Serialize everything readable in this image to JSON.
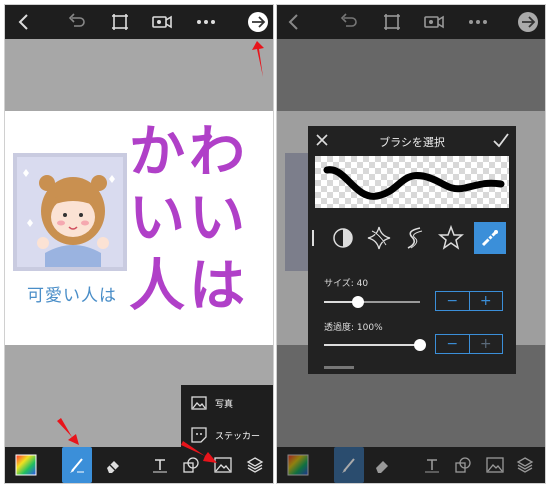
{
  "left_screen": {
    "context_menu": {
      "items": [
        {
          "label": "写真",
          "icon": "photo-icon"
        },
        {
          "label": "ステッカー",
          "icon": "sticker-icon"
        }
      ]
    },
    "canvas_art": {
      "main_text": [
        "かわ",
        "いい",
        "人は"
      ],
      "sub_text": "可愛い人は"
    },
    "annotation_color": "#e8141b"
  },
  "right_screen": {
    "dialog": {
      "title": "ブラシを選択",
      "size_label": "サイズ: 40",
      "size_value": 40,
      "size_level": 0.35,
      "opacity_label": "透過度: 100%",
      "opacity_value": 100,
      "opacity_level": 1.0,
      "accent": "#3b8fd9"
    }
  },
  "colors": {
    "bar": "#1e1e1e",
    "workspace": "#a7a7a7",
    "purple_text": "#b040c8",
    "blue_text": "#4a8ec8"
  }
}
